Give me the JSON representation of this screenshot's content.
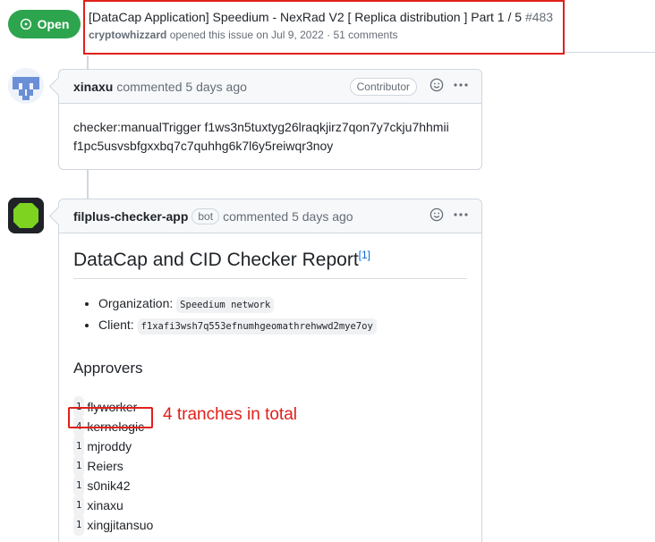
{
  "issue": {
    "state_label": "Open",
    "title": "[DataCap Application] Speedium - NexRad V2 [ Replica distribution ] Part 1 / 5",
    "number": "#483",
    "author": "cryptowhizzard",
    "meta_text": "opened this issue on Jul 9, 2022 · 51 comments"
  },
  "comments": [
    {
      "user": "xinaxu",
      "action": "commented 5 days ago",
      "role_badge": "Contributor",
      "body_line1": "checker:manualTrigger f1ws3n5tuxtyg26lraqkjirz7qon7y7ckju7hhmii",
      "body_line2": "f1pc5usvsbfgxxbq7c7quhhg6k7l6y5reiwqr3noy"
    },
    {
      "user": "filplus-checker-app",
      "bot_badge": "bot",
      "action": "commented 5 days ago",
      "report_title": "DataCap and CID Checker Report",
      "footnote": "[1]",
      "organization_label": "Organization:",
      "organization_value": "Speedium network",
      "client_label": "Client:",
      "client_value": "f1xafi3wsh7q553efnumhgeomathrehwwd2mye7oy",
      "approvers_heading": "Approvers",
      "approvers": [
        {
          "count": "1",
          "name": "flyworker"
        },
        {
          "count": "4",
          "name": "kernelogic"
        },
        {
          "count": "1",
          "name": "mjroddy"
        },
        {
          "count": "1",
          "name": "Reiers"
        },
        {
          "count": "1",
          "name": "s0nik42"
        },
        {
          "count": "1",
          "name": "xinaxu"
        },
        {
          "count": "1",
          "name": "xingjitansuo"
        }
      ]
    }
  ],
  "annotation": {
    "text": "4 tranches in total",
    "color": "#e0201b"
  },
  "colors": {
    "open_green": "#2da44e",
    "link_blue": "#0969da"
  },
  "icons": [
    "issue-opened-icon",
    "smiley-icon",
    "kebab-icon"
  ]
}
